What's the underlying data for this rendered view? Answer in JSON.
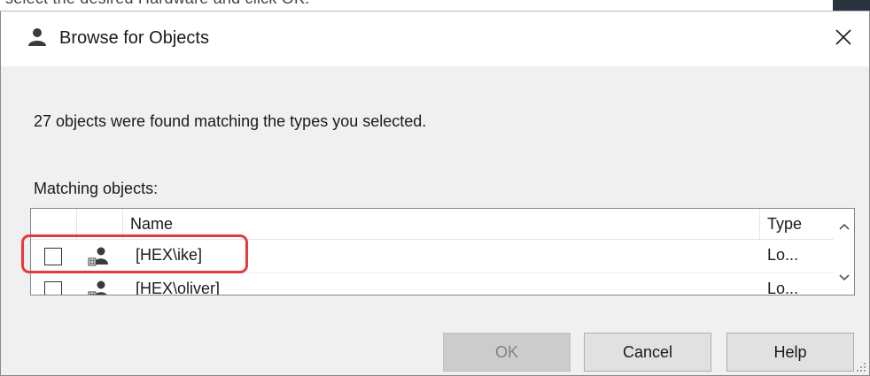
{
  "background": {
    "partial_text": "select the desired Hardware and click OK."
  },
  "dialog": {
    "title": "Browse for Objects",
    "close_glyph": "✕",
    "message": "27 objects were found matching the types you selected.",
    "matching_label": "Matching objects:",
    "columns": {
      "name": "Name",
      "type": "Type"
    },
    "rows": [
      {
        "name": "[HEX\\ike]",
        "type": "Lo...",
        "checked": false,
        "icon": "local-user-icon"
      },
      {
        "name": "[HEX\\oliver]",
        "type": "Lo...",
        "checked": false,
        "icon": "local-user-icon"
      }
    ],
    "buttons": {
      "ok": "OK",
      "cancel": "Cancel",
      "help": "Help"
    },
    "ok_enabled": false
  },
  "colors": {
    "highlight": "#e83a3a",
    "dialog_bg": "#f0f0f0",
    "button_bg": "#e1e1e1",
    "disabled_button_bg": "#cccccc"
  }
}
